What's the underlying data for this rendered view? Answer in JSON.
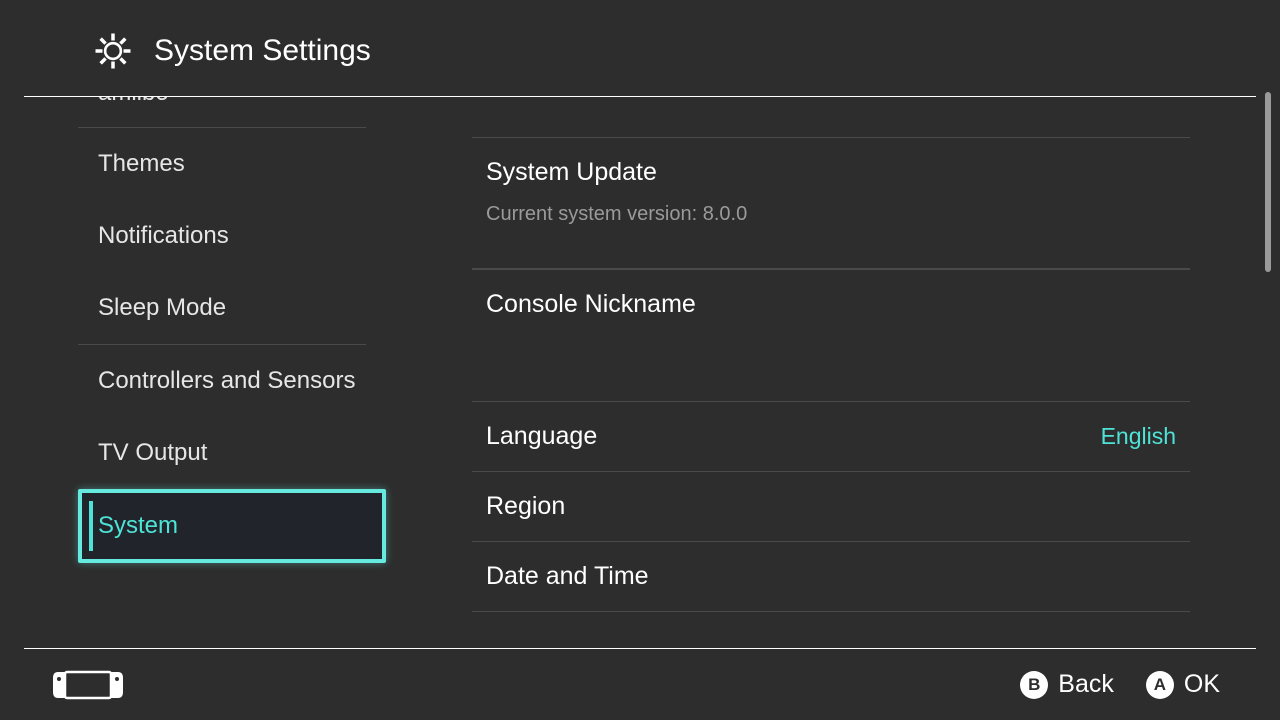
{
  "header": {
    "title": "System Settings"
  },
  "sidebar": {
    "items": [
      {
        "label": "amiibo"
      },
      {
        "label": "Themes"
      },
      {
        "label": "Notifications"
      },
      {
        "label": "Sleep Mode"
      },
      {
        "label": "Controllers and Sensors"
      },
      {
        "label": "TV Output"
      },
      {
        "label": "System"
      }
    ]
  },
  "main": {
    "system_update": {
      "label": "System Update",
      "subtext": "Current system version: 8.0.0"
    },
    "console_nickname": {
      "label": "Console Nickname"
    },
    "language": {
      "label": "Language",
      "value": "English"
    },
    "region": {
      "label": "Region"
    },
    "date_time": {
      "label": "Date and Time"
    }
  },
  "footer": {
    "back": {
      "key": "B",
      "label": "Back"
    },
    "ok": {
      "key": "A",
      "label": "OK"
    }
  }
}
